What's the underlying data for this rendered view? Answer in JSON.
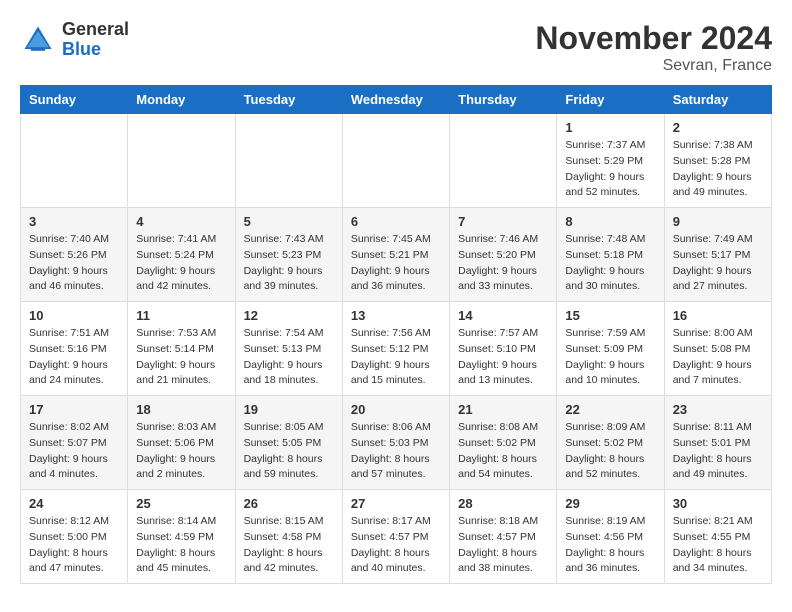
{
  "header": {
    "logo_general": "General",
    "logo_blue": "Blue",
    "title": "November 2024",
    "location": "Sevran, France"
  },
  "weekdays": [
    "Sunday",
    "Monday",
    "Tuesday",
    "Wednesday",
    "Thursday",
    "Friday",
    "Saturday"
  ],
  "weeks": [
    [
      null,
      null,
      null,
      null,
      null,
      {
        "day": "1",
        "sunrise": "Sunrise: 7:37 AM",
        "sunset": "Sunset: 5:29 PM",
        "daylight": "Daylight: 9 hours and 52 minutes."
      },
      {
        "day": "2",
        "sunrise": "Sunrise: 7:38 AM",
        "sunset": "Sunset: 5:28 PM",
        "daylight": "Daylight: 9 hours and 49 minutes."
      }
    ],
    [
      {
        "day": "3",
        "sunrise": "Sunrise: 7:40 AM",
        "sunset": "Sunset: 5:26 PM",
        "daylight": "Daylight: 9 hours and 46 minutes."
      },
      {
        "day": "4",
        "sunrise": "Sunrise: 7:41 AM",
        "sunset": "Sunset: 5:24 PM",
        "daylight": "Daylight: 9 hours and 42 minutes."
      },
      {
        "day": "5",
        "sunrise": "Sunrise: 7:43 AM",
        "sunset": "Sunset: 5:23 PM",
        "daylight": "Daylight: 9 hours and 39 minutes."
      },
      {
        "day": "6",
        "sunrise": "Sunrise: 7:45 AM",
        "sunset": "Sunset: 5:21 PM",
        "daylight": "Daylight: 9 hours and 36 minutes."
      },
      {
        "day": "7",
        "sunrise": "Sunrise: 7:46 AM",
        "sunset": "Sunset: 5:20 PM",
        "daylight": "Daylight: 9 hours and 33 minutes."
      },
      {
        "day": "8",
        "sunrise": "Sunrise: 7:48 AM",
        "sunset": "Sunset: 5:18 PM",
        "daylight": "Daylight: 9 hours and 30 minutes."
      },
      {
        "day": "9",
        "sunrise": "Sunrise: 7:49 AM",
        "sunset": "Sunset: 5:17 PM",
        "daylight": "Daylight: 9 hours and 27 minutes."
      }
    ],
    [
      {
        "day": "10",
        "sunrise": "Sunrise: 7:51 AM",
        "sunset": "Sunset: 5:16 PM",
        "daylight": "Daylight: 9 hours and 24 minutes."
      },
      {
        "day": "11",
        "sunrise": "Sunrise: 7:53 AM",
        "sunset": "Sunset: 5:14 PM",
        "daylight": "Daylight: 9 hours and 21 minutes."
      },
      {
        "day": "12",
        "sunrise": "Sunrise: 7:54 AM",
        "sunset": "Sunset: 5:13 PM",
        "daylight": "Daylight: 9 hours and 18 minutes."
      },
      {
        "day": "13",
        "sunrise": "Sunrise: 7:56 AM",
        "sunset": "Sunset: 5:12 PM",
        "daylight": "Daylight: 9 hours and 15 minutes."
      },
      {
        "day": "14",
        "sunrise": "Sunrise: 7:57 AM",
        "sunset": "Sunset: 5:10 PM",
        "daylight": "Daylight: 9 hours and 13 minutes."
      },
      {
        "day": "15",
        "sunrise": "Sunrise: 7:59 AM",
        "sunset": "Sunset: 5:09 PM",
        "daylight": "Daylight: 9 hours and 10 minutes."
      },
      {
        "day": "16",
        "sunrise": "Sunrise: 8:00 AM",
        "sunset": "Sunset: 5:08 PM",
        "daylight": "Daylight: 9 hours and 7 minutes."
      }
    ],
    [
      {
        "day": "17",
        "sunrise": "Sunrise: 8:02 AM",
        "sunset": "Sunset: 5:07 PM",
        "daylight": "Daylight: 9 hours and 4 minutes."
      },
      {
        "day": "18",
        "sunrise": "Sunrise: 8:03 AM",
        "sunset": "Sunset: 5:06 PM",
        "daylight": "Daylight: 9 hours and 2 minutes."
      },
      {
        "day": "19",
        "sunrise": "Sunrise: 8:05 AM",
        "sunset": "Sunset: 5:05 PM",
        "daylight": "Daylight: 8 hours and 59 minutes."
      },
      {
        "day": "20",
        "sunrise": "Sunrise: 8:06 AM",
        "sunset": "Sunset: 5:03 PM",
        "daylight": "Daylight: 8 hours and 57 minutes."
      },
      {
        "day": "21",
        "sunrise": "Sunrise: 8:08 AM",
        "sunset": "Sunset: 5:02 PM",
        "daylight": "Daylight: 8 hours and 54 minutes."
      },
      {
        "day": "22",
        "sunrise": "Sunrise: 8:09 AM",
        "sunset": "Sunset: 5:02 PM",
        "daylight": "Daylight: 8 hours and 52 minutes."
      },
      {
        "day": "23",
        "sunrise": "Sunrise: 8:11 AM",
        "sunset": "Sunset: 5:01 PM",
        "daylight": "Daylight: 8 hours and 49 minutes."
      }
    ],
    [
      {
        "day": "24",
        "sunrise": "Sunrise: 8:12 AM",
        "sunset": "Sunset: 5:00 PM",
        "daylight": "Daylight: 8 hours and 47 minutes."
      },
      {
        "day": "25",
        "sunrise": "Sunrise: 8:14 AM",
        "sunset": "Sunset: 4:59 PM",
        "daylight": "Daylight: 8 hours and 45 minutes."
      },
      {
        "day": "26",
        "sunrise": "Sunrise: 8:15 AM",
        "sunset": "Sunset: 4:58 PM",
        "daylight": "Daylight: 8 hours and 42 minutes."
      },
      {
        "day": "27",
        "sunrise": "Sunrise: 8:17 AM",
        "sunset": "Sunset: 4:57 PM",
        "daylight": "Daylight: 8 hours and 40 minutes."
      },
      {
        "day": "28",
        "sunrise": "Sunrise: 8:18 AM",
        "sunset": "Sunset: 4:57 PM",
        "daylight": "Daylight: 8 hours and 38 minutes."
      },
      {
        "day": "29",
        "sunrise": "Sunrise: 8:19 AM",
        "sunset": "Sunset: 4:56 PM",
        "daylight": "Daylight: 8 hours and 36 minutes."
      },
      {
        "day": "30",
        "sunrise": "Sunrise: 8:21 AM",
        "sunset": "Sunset: 4:55 PM",
        "daylight": "Daylight: 8 hours and 34 minutes."
      }
    ]
  ]
}
